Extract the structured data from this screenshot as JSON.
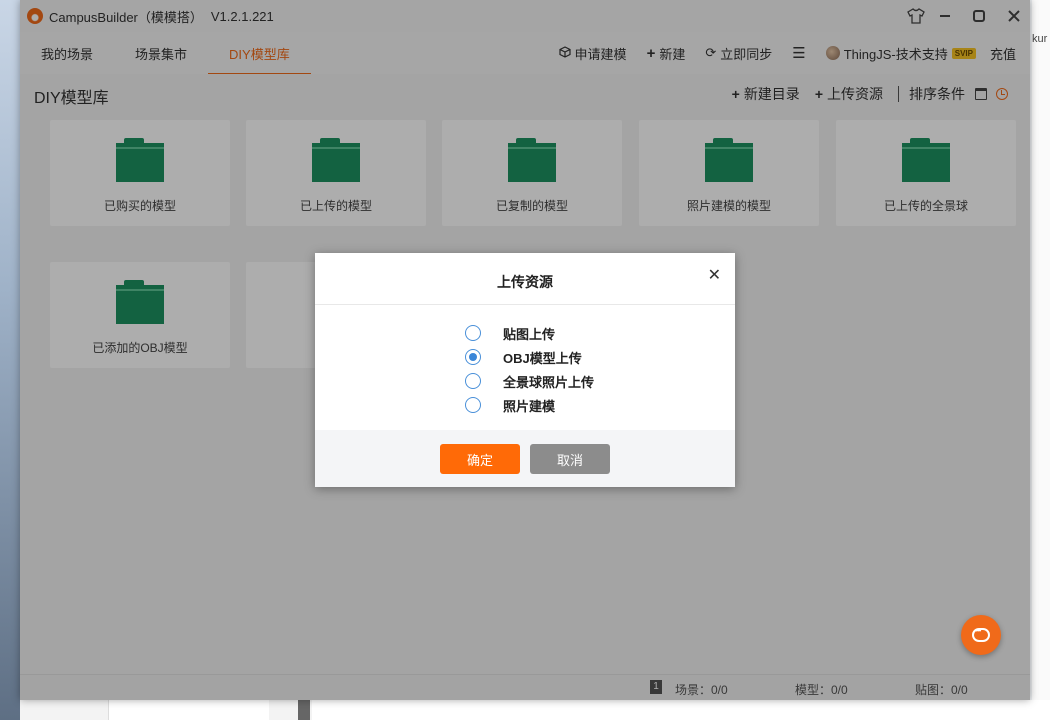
{
  "window": {
    "app_title": "CampusBuilder（模模搭）",
    "version": "V1.2.1.221"
  },
  "nav": {
    "tabs": [
      {
        "label": "我的场景"
      },
      {
        "label": "场景集市"
      },
      {
        "label": "DIY模型库"
      }
    ],
    "active_tab": "DIY模型库",
    "actions": {
      "apply_modeling": "申请建模",
      "new": "新建",
      "sync_now": "立即同步",
      "user_name": "ThingJS-技术支持",
      "vip_badge": "SVIP",
      "recharge": "充值"
    }
  },
  "library": {
    "title": "DIY模型库",
    "new_folder": "新建目录",
    "upload_resource": "上传资源",
    "sort_conditions": "排序条件",
    "folders": [
      {
        "label": "已购买的模型"
      },
      {
        "label": "已上传的模型"
      },
      {
        "label": "已复制的模型"
      },
      {
        "label": "照片建模的模型"
      },
      {
        "label": "已上传的全景球"
      },
      {
        "label": "已添加的OBJ模型"
      }
    ]
  },
  "status": {
    "page_badge": "1",
    "scenes": "场景：0/0",
    "models": "模型：0/0",
    "textures": "贴图：0/0"
  },
  "dialog": {
    "title": "上传资源",
    "options": [
      {
        "label": "贴图上传",
        "checked": false
      },
      {
        "label": "OBJ模型上传",
        "checked": true
      },
      {
        "label": "全景球照片上传",
        "checked": false
      },
      {
        "label": "照片建模",
        "checked": false
      }
    ],
    "confirm_label": "确定",
    "cancel_label": "取消"
  },
  "desktop": {
    "right_fragment": "kur"
  },
  "colors": {
    "accent": "#f06a1a",
    "folder_green": "#1d9160",
    "radio_blue": "#3a86d8",
    "confirm_button": "#ff6a07",
    "cancel_button": "#8c8c8c"
  }
}
